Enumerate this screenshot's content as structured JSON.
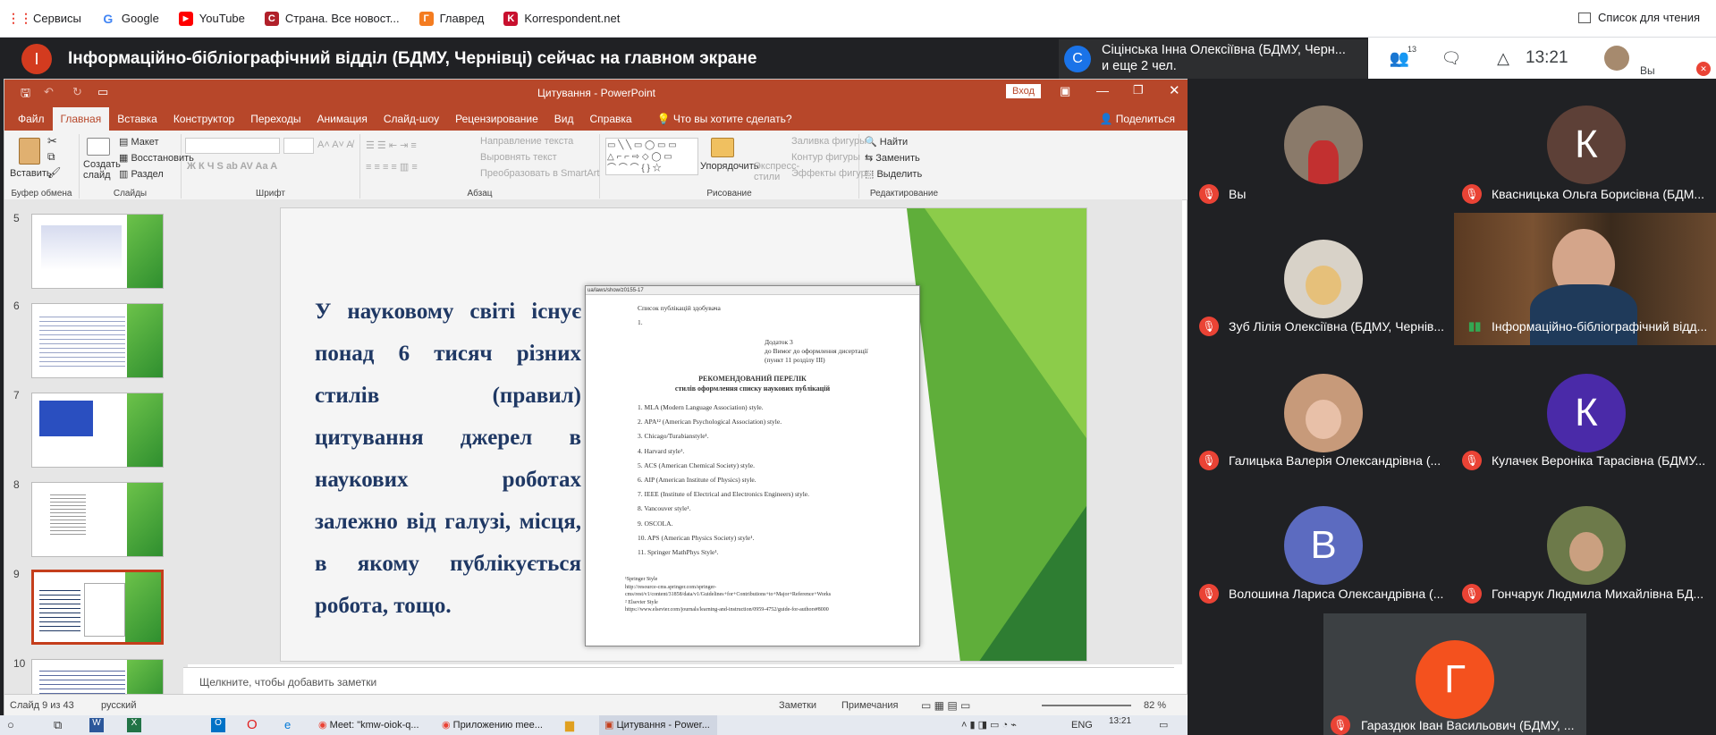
{
  "bookmarks": [
    {
      "label": "Сервисы",
      "icon": "apps-grid-icon",
      "color": "#ea4335"
    },
    {
      "label": "Google",
      "icon": "google-icon",
      "color": "#4285f4"
    },
    {
      "label": "YouTube",
      "icon": "youtube-icon",
      "color": "#ff0000"
    },
    {
      "label": "Страна. Все новост...",
      "icon": "strana-icon",
      "color": "#b1202a"
    },
    {
      "label": "Главред",
      "icon": "glavred-icon",
      "color": "#f47c20"
    },
    {
      "label": "Korrespondent.net",
      "icon": "korrespondent-icon",
      "color": "#c8102e"
    }
  ],
  "reading_list": "Список для чтения",
  "meet": {
    "presenter_initial": "І",
    "presenter_text": "Інформаційно-бібліографічний відділ (БДМУ, Чернівці) сейчас на главном экране",
    "speaker_initial": "С",
    "speaker_text_1": "Сіцінська Інна Олексіївна (БДМУ, Черн...",
    "speaker_text_2": "и еще 2 чел.",
    "participants_count": "13",
    "clock": "13:21",
    "you": "Вы"
  },
  "ppt": {
    "title": "Цитування  -  PowerPoint",
    "login": "Вход",
    "share": "Поделиться",
    "tell_me": "Что вы хотите сделать?",
    "menu": [
      "Файл",
      "Главная",
      "Вставка",
      "Конструктор",
      "Переходы",
      "Анимация",
      "Слайд-шоу",
      "Рецензирование",
      "Вид",
      "Справка"
    ],
    "ribbon": {
      "paste": "Вставить",
      "clipboard": "Буфер обмена",
      "new_slide": "Создать слайд",
      "layout": "Макет",
      "restore": "Восстановить",
      "section": "Раздел",
      "slides": "Слайды",
      "font": "Шрифт",
      "paragraph": "Абзац",
      "text_dir": "Направление текста",
      "align_text": "Выровнять текст",
      "smartart": "Преобразовать в SmartArt",
      "arrange": "Упорядочить",
      "quick_styles": "Экспресс-стили",
      "fill": "Заливка фигуры",
      "outline": "Контур фигуры",
      "effects": "Эффекты фигуры",
      "drawing": "Рисование",
      "find": "Найти",
      "replace": "Заменить",
      "select": "Выделить",
      "editing": "Редактирование"
    },
    "thumb_numbers": [
      "5",
      "6",
      "7",
      "8",
      "9",
      "10"
    ],
    "slide_text": "У науковому світі існує понад 6 тисяч різних стилів (правил) цитування джерел в наукових роботах залежно від галузі, місця, в якому публікується робота, тощо.",
    "doc": {
      "url": "ua/laws/show/z0155-17",
      "top_line": "Список публікацій здобувача",
      "num1": "1.",
      "appendix1": "Додаток 3",
      "appendix2": "до Вимог до оформлення дисертації",
      "appendix3": "(пункт 11 розділу III)",
      "heading1": "РЕКОМЕНДОВАНИЙ ПЕРЕЛІК",
      "heading2": "стилів оформлення списку наукових публікацій",
      "items": [
        "1. MLA (Modern Language Association) style.",
        "2. APA¹² (American Psychological Association) style.",
        "3. Chicago/Turabianstyle¹.",
        "4. Harvard style¹.",
        "5. ACS (American Chemical Society) style.",
        "6. AIP (American Institute of Physics) style.",
        "7. IEEE (Institute of Electrical and Electronics Engineers) style.",
        "8. Vancouver style¹.",
        "9. OSCOLA.",
        "10. APS (American Physics Society) style¹.",
        "11. Springer MathPhys Style¹."
      ],
      "foot1": "¹Springer Style",
      "foot2": "http://resource-cms.springer.com/springer-",
      "foot3": "cms/rest/v1/content/31858/data/v1/Guidelines+for+Contributions+to+Major+Reference+Works",
      "foot4": "² Elsevier Style",
      "foot5": "https://www.elsevier.com/journals/learning-and-instruction/0959-4752/guide-for-authors#8000"
    },
    "notes_placeholder": "Щелкните, чтобы добавить заметки",
    "status_slide": "Слайд 9 из 43",
    "status_lang": "русский",
    "status_notes": "Заметки",
    "status_comments": "Примечания",
    "zoom": "82 %"
  },
  "taskbar": {
    "apps": [
      "Meet: \"kmw-oiok-q...",
      "Приложению mee...",
      "Цитування - Power..."
    ],
    "lang": "ENG",
    "time": "13:21"
  },
  "participants": [
    {
      "name": "Вы",
      "initial": "",
      "color": "#8a7a6a",
      "photo": true
    },
    {
      "name": "Квасницька Ольга Борисівна (БДМ...",
      "initial": "К",
      "color": "#5d4037",
      "photo": false
    },
    {
      "name": "Зуб Лілія Олексіївна (БДМУ, Чернів...",
      "initial": "",
      "color": "#b8b4a6",
      "photo": true
    },
    {
      "name": "Інформаційно-бібліографічний відд...",
      "initial": "",
      "color": "#6b4a2f",
      "photo": true
    },
    {
      "name": "Галицька Валерія Олександрівна (...",
      "initial": "",
      "color": "#c79a7a",
      "photo": true
    },
    {
      "name": "Кулачек Вероніка Тарасівна (БДМУ...",
      "initial": "К",
      "color": "#4a2aa8",
      "photo": false
    },
    {
      "name": "Волошина Лариса Олександрівна (...",
      "initial": "В",
      "color": "#5c6bc0",
      "photo": false
    },
    {
      "name": "Гончарук Людмила Михайлівна БД...",
      "initial": "",
      "color": "#6d7a4a",
      "photo": true
    },
    {
      "name": "Гараздюк Іван Васильович (БДМУ, ...",
      "initial": "Г",
      "color": "#f4511e",
      "photo": false
    }
  ]
}
